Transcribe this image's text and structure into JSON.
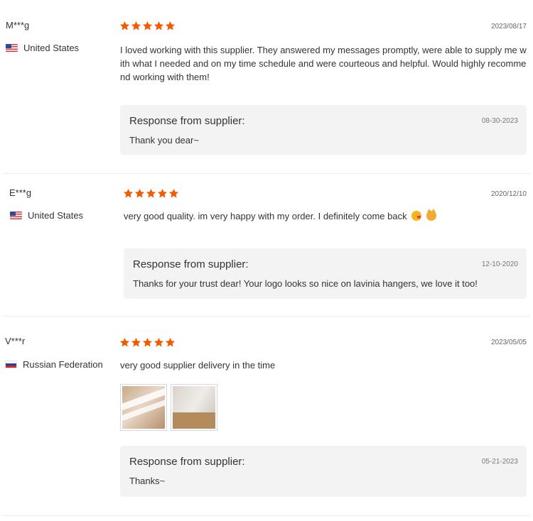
{
  "colors": {
    "star": "#f25a00",
    "response_bg": "#f3f3f3",
    "divider": "#ececec"
  },
  "reviews": [
    {
      "user": "M***g",
      "country": "United States",
      "flag": "us-flag-icon",
      "rating": 5,
      "date": "2023/08/17",
      "comment": "I loved working with this supplier. They answered my messages promptly, were able to supply me with what I needed and on my time schedule and were courteous and helpful. Would highly recommend working with them!",
      "response": {
        "title": "Response from supplier:",
        "date": "08-30-2023",
        "text": "Thank you dear~"
      }
    },
    {
      "user": "E***g",
      "country": "United States",
      "flag": "us-flag-icon",
      "rating": 5,
      "date": "2020/12/10",
      "comment": "very good quality. im very happy with my order. I definitely come back",
      "response": {
        "title": "Response from supplier:",
        "date": "12-10-2020",
        "text": "Thanks for your trust dear! Your logo looks so nice on lavinia hangers, we love it too!"
      }
    },
    {
      "user": "V***r",
      "country": "Russian Federation",
      "flag": "russia-flag-icon",
      "rating": 5,
      "date": "2023/05/05",
      "comment": "very good supplier delivery in the time",
      "photos": [
        "review-photo-hangers",
        "review-photo-box"
      ],
      "response": {
        "title": "Response from supplier:",
        "date": "05-21-2023",
        "text": "Thanks~"
      }
    }
  ]
}
